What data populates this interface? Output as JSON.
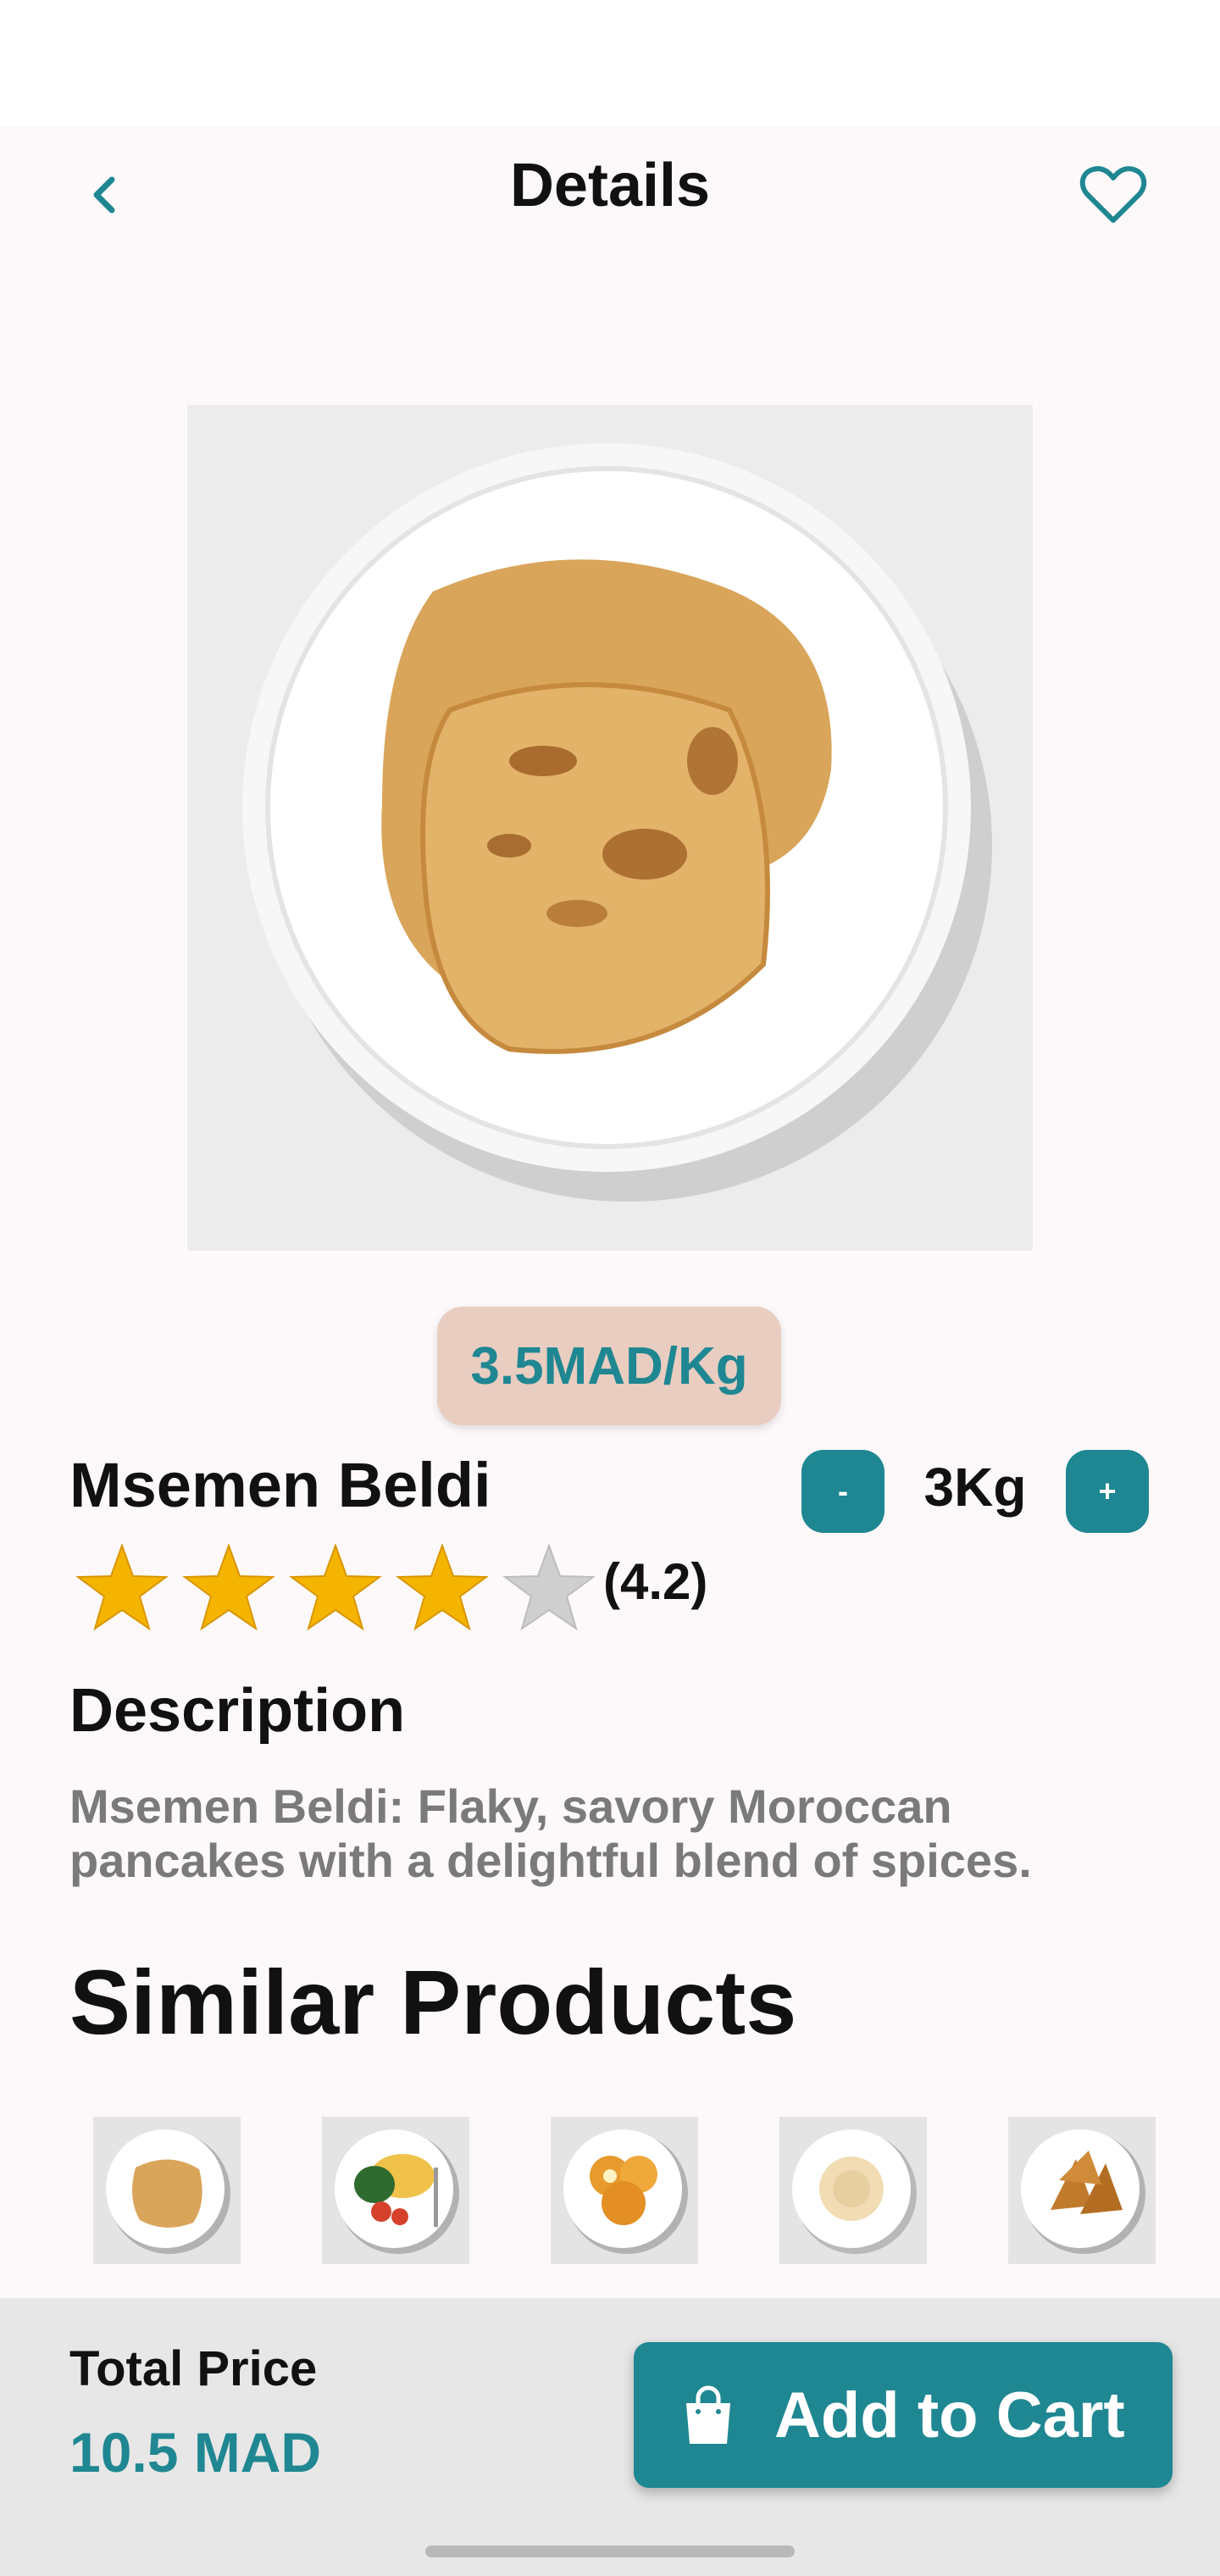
{
  "header": {
    "title": "Details",
    "back_icon": "chevron-left-icon",
    "favorite_icon": "heart-outline-icon"
  },
  "product": {
    "image_alt": "Msemen on a white plate",
    "price_per_unit": "3.5MAD/Kg",
    "name": "Msemen Beldi",
    "quantity": "3Kg",
    "decrease_label": "-",
    "increase_label": "+",
    "rating": 4.2,
    "rating_text": "(4.2)",
    "stars_total": 5
  },
  "description": {
    "title": "Description",
    "text": "Msemen Beldi: Flaky, savory Moroccan pancakes with a delightful blend of spices."
  },
  "similar": {
    "title": "Similar Products",
    "items": [
      "msemen",
      "omelette-plate",
      "fried-pastries",
      "hummus",
      "samosas"
    ]
  },
  "footer": {
    "total_label": "Total Price",
    "total_value": "10.5 MAD",
    "cart_label": "Add to Cart",
    "cart_icon": "shopping-bag-icon"
  },
  "colors": {
    "accent": "#1f8792",
    "price_pill": "#e9cdc1",
    "star_active": "#f5b400",
    "star_inactive": "#cfcfcf",
    "background": "#fdf9fb"
  }
}
